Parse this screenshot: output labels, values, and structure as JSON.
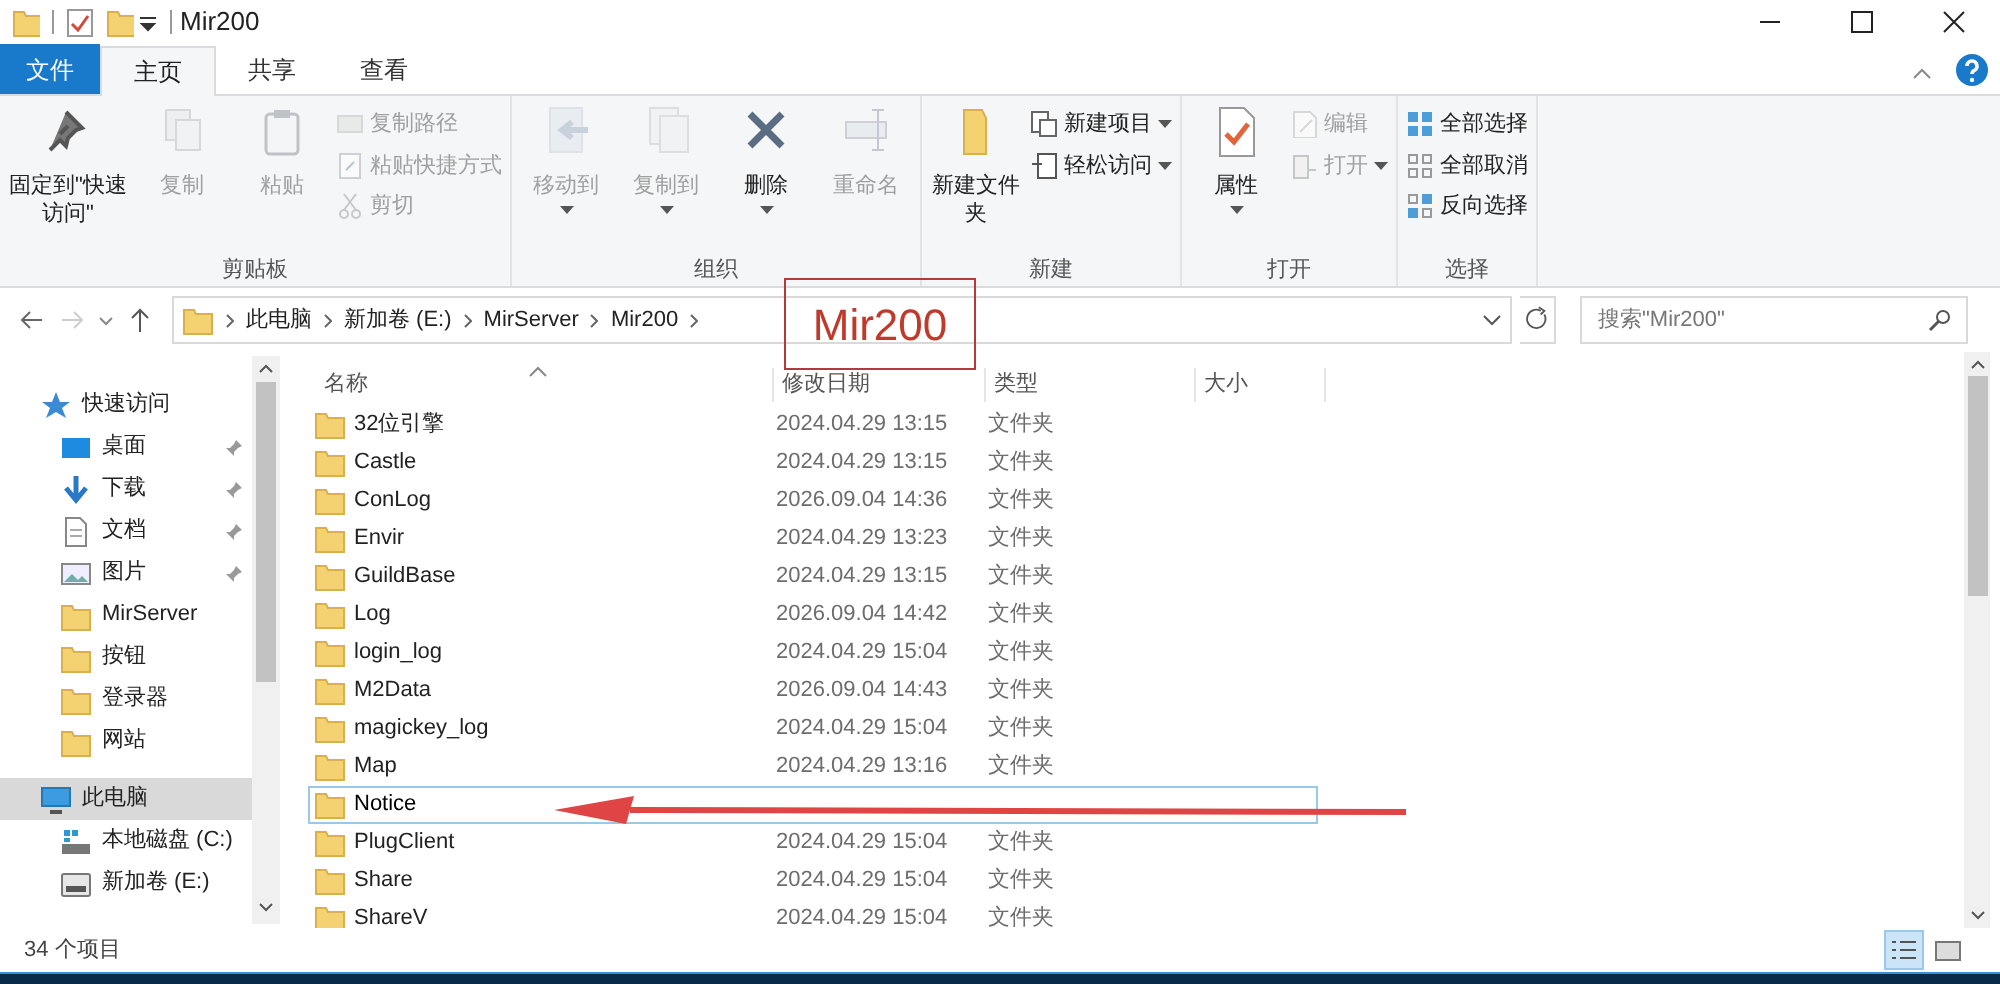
{
  "window": {
    "title": "Mir200"
  },
  "tabs": [
    {
      "label": "文件",
      "kind": "file",
      "selected": false
    },
    {
      "label": "主页",
      "kind": "tab",
      "selected": true
    },
    {
      "label": "共享",
      "kind": "tab",
      "selected": false
    },
    {
      "label": "查看",
      "kind": "tab",
      "selected": false
    }
  ],
  "ribbon": {
    "groups": [
      {
        "label": "剪贴板",
        "items": [
          {
            "kind": "large",
            "label": "固定到\"快速访问\"",
            "disabled": false,
            "dropdown": false
          },
          {
            "kind": "large",
            "label": "复制",
            "disabled": true,
            "dropdown": false
          },
          {
            "kind": "large",
            "label": "粘贴",
            "disabled": true,
            "dropdown": false
          },
          {
            "kind": "small",
            "label": "复制路径",
            "disabled": true,
            "dropdown": false
          },
          {
            "kind": "small",
            "label": "粘贴快捷方式",
            "disabled": true,
            "dropdown": false
          },
          {
            "kind": "small",
            "label": "剪切",
            "disabled": true,
            "dropdown": false
          }
        ]
      },
      {
        "label": "组织",
        "items": [
          {
            "kind": "large",
            "label": "移动到",
            "disabled": true,
            "dropdown": true
          },
          {
            "kind": "large",
            "label": "复制到",
            "disabled": true,
            "dropdown": true
          },
          {
            "kind": "large",
            "label": "删除",
            "disabled": false,
            "dropdown": true
          },
          {
            "kind": "large",
            "label": "重命名",
            "disabled": true,
            "dropdown": false
          }
        ]
      },
      {
        "label": "新建",
        "items": [
          {
            "kind": "large",
            "label": "新建文件夹",
            "disabled": false,
            "dropdown": false
          },
          {
            "kind": "small",
            "label": "新建项目",
            "disabled": false,
            "dropdown": true
          },
          {
            "kind": "small",
            "label": "轻松访问",
            "disabled": false,
            "dropdown": true
          }
        ]
      },
      {
        "label": "打开",
        "items": [
          {
            "kind": "large",
            "label": "属性",
            "disabled": false,
            "dropdown": true
          },
          {
            "kind": "small",
            "label": "编辑",
            "disabled": true,
            "dropdown": false
          },
          {
            "kind": "small",
            "label": "打开",
            "disabled": true,
            "dropdown": true
          }
        ]
      },
      {
        "label": "选择",
        "items": [
          {
            "kind": "small",
            "label": "全部选择",
            "disabled": false,
            "dropdown": false
          },
          {
            "kind": "small",
            "label": "全部取消",
            "disabled": false,
            "dropdown": false
          },
          {
            "kind": "small",
            "label": "反向选择",
            "disabled": false,
            "dropdown": false
          }
        ]
      }
    ]
  },
  "address": {
    "crumbs": [
      "此电脑",
      "新加卷 (E:)",
      "MirServer",
      "Mir200"
    ],
    "search_placeholder": "搜索\"Mir200\""
  },
  "sidebar": {
    "items": [
      {
        "label": "快速访问",
        "kind": "star",
        "selected": false,
        "children": [
          {
            "label": "桌面",
            "kind": "desktop",
            "pinned": true
          },
          {
            "label": "下载",
            "kind": "download",
            "pinned": true
          },
          {
            "label": "文档",
            "kind": "document",
            "pinned": true
          },
          {
            "label": "图片",
            "kind": "picture",
            "pinned": true
          },
          {
            "label": "MirServer",
            "kind": "folder",
            "pinned": false
          },
          {
            "label": "按钮",
            "kind": "folder",
            "pinned": false
          },
          {
            "label": "登录器",
            "kind": "folder",
            "pinned": false
          },
          {
            "label": "网站",
            "kind": "folder",
            "pinned": false
          }
        ]
      },
      {
        "label": "此电脑",
        "kind": "pc",
        "selected": true,
        "children": [
          {
            "label": "本地磁盘 (C:)",
            "kind": "system-drive",
            "pinned": false
          },
          {
            "label": "新加卷 (E:)",
            "kind": "drive",
            "pinned": false
          }
        ]
      }
    ]
  },
  "table": {
    "columns": [
      "名称",
      "修改日期",
      "类型",
      "大小"
    ],
    "rows": [
      {
        "name": "32位引擎",
        "date": "2024.04.29 13:15",
        "type": "文件夹",
        "selected": false
      },
      {
        "name": "Castle",
        "date": "2024.04.29 13:15",
        "type": "文件夹",
        "selected": false
      },
      {
        "name": "ConLog",
        "date": "2026.09.04 14:36",
        "type": "文件夹",
        "selected": false
      },
      {
        "name": "Envir",
        "date": "2024.04.29 13:23",
        "type": "文件夹",
        "selected": false
      },
      {
        "name": "GuildBase",
        "date": "2024.04.29 13:15",
        "type": "文件夹",
        "selected": false
      },
      {
        "name": "Log",
        "date": "2026.09.04 14:42",
        "type": "文件夹",
        "selected": false
      },
      {
        "name": "login_log",
        "date": "2024.04.29 15:04",
        "type": "文件夹",
        "selected": false
      },
      {
        "name": "M2Data",
        "date": "2026.09.04 14:43",
        "type": "文件夹",
        "selected": false
      },
      {
        "name": "magickey_log",
        "date": "2024.04.29 15:04",
        "type": "文件夹",
        "selected": false
      },
      {
        "name": "Map",
        "date": "2024.04.29 13:16",
        "type": "文件夹",
        "selected": false
      },
      {
        "name": "Notice",
        "selected": true
      },
      {
        "name": "PlugClient",
        "date": "2024.04.29 15:04",
        "type": "文件夹",
        "selected": false
      },
      {
        "name": "Share",
        "date": "2024.04.29 15:04",
        "type": "文件夹",
        "selected": false
      },
      {
        "name": "ShareV",
        "date": "2024.04.29 15:04",
        "type": "文件夹",
        "selected": false
      }
    ]
  },
  "annotation": {
    "label": "Mir200"
  },
  "status_bar": {
    "count": "34 个项目",
    "views": [
      {
        "kind": "details",
        "selected": true
      },
      {
        "kind": "tiles",
        "selected": false
      }
    ]
  }
}
